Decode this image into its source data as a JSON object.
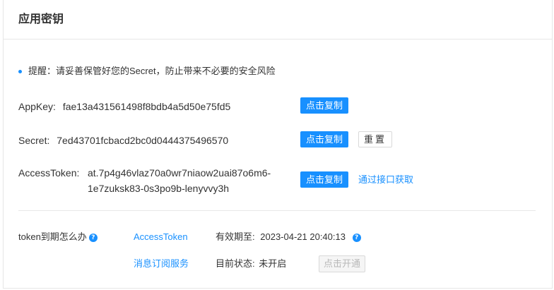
{
  "card": {
    "title": "应用密钥"
  },
  "tip": {
    "text": "提醒：请妥善保管好您的Secret，防止带来不必要的安全风险"
  },
  "appkey": {
    "label": "AppKey:",
    "value": "fae13a431561498f8bdb4a5d50e75fd5",
    "copy_label": "点击复制"
  },
  "secret": {
    "label": "Secret:",
    "value": "7ed43701fcbacd2bc0d0444375496570",
    "copy_label": "点击复制",
    "reset_label": "重置"
  },
  "access_token": {
    "label": "AccessToken:",
    "value_line1": "at.7p4g46vlaz70a0wr7niaow2uai87o6m6-",
    "value_line2": "1e7zuksk83-0s3po9b-lenyvvy3h",
    "copy_label": "点击复制",
    "api_link": "通过接口获取"
  },
  "token_expiry": {
    "question": "token到期怎么办",
    "link": "AccessToken",
    "valid_label": "有效期至:",
    "valid_value": "2023-04-21 20:40:13"
  },
  "subscription": {
    "link": "消息订阅服务",
    "status_label": "目前状态:",
    "status_value": "未开启",
    "enable_label": "点击开通"
  },
  "colors": {
    "primary": "#1890ff",
    "border": "#e8e8e8",
    "text": "#333333",
    "disabled_text": "#b8b8b8"
  }
}
